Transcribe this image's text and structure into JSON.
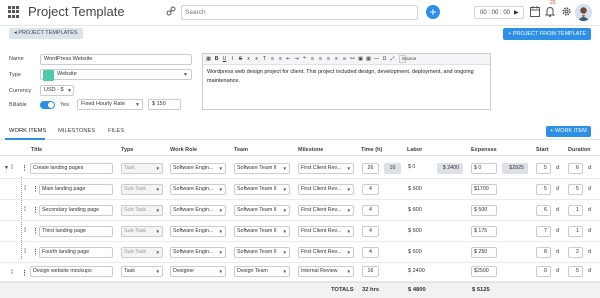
{
  "header": {
    "title": "Project Template",
    "search_placeholder": "Search",
    "timer": "00 : 00 : 00",
    "notification_count": "20"
  },
  "subheader": {
    "back_label": "PROJECT TEMPLATES",
    "from_template_label": "PROJECT FROM TEMPLATE"
  },
  "form": {
    "name_label": "Name",
    "name_value": "WordPress Website",
    "type_label": "Type",
    "type_value": "Website",
    "type_color": "#4ec9b0",
    "currency_label": "Currency",
    "currency_value": "USD - $",
    "billable_label": "Billable",
    "billable_toggle": "Yes",
    "rate_type": "Fixed Hourly Rate",
    "rate_value": "$ 150"
  },
  "editor": {
    "source_label": "Source",
    "text": "Wordpress web design project for client. This project included design, development, deployment, and ongoing maintenance."
  },
  "tabs": [
    {
      "label": "WORK ITEMS",
      "active": true
    },
    {
      "label": "MILESTONES",
      "active": false
    },
    {
      "label": "FILES",
      "active": false
    }
  ],
  "add_work_item_label": "WORK ITEM",
  "columns": {
    "title": "Title",
    "type": "Type",
    "role": "Work Role",
    "team": "Team",
    "milestone": "Milestone",
    "time": "Time (h)",
    "labor": "Labor",
    "expenses": "Expenses",
    "start": "Start",
    "duration": "Duration"
  },
  "rows": [
    {
      "title": "Create landing pages",
      "type": "Task",
      "role": "Software Engin...",
      "team": "Software Team II",
      "milestone": "First Client Rev...",
      "time": "26",
      "time_extra": "16",
      "labor": "$ 0",
      "labor_extra": "$ 2400",
      "expenses": "$ 0",
      "expenses_extra": "$2925",
      "start": "5",
      "start_unit": "d",
      "duration": "6",
      "duration_unit": "d"
    },
    {
      "title": "Main landing page",
      "type": "Sub-Task",
      "role": "Software Engin...",
      "team": "Software Team II",
      "milestone": "First Client Rev...",
      "time": "4",
      "labor": "$ 600",
      "expenses": "$1700",
      "start": "5",
      "start_unit": "d",
      "duration": "5",
      "duration_unit": "d"
    },
    {
      "title": "Secondary landing page",
      "type": "Sub-Task",
      "role": "Software Engin...",
      "team": "Software Team II",
      "milestone": "First Client Rev...",
      "time": "4",
      "labor": "$ 600",
      "expenses": "$  500",
      "start": "6",
      "start_unit": "d",
      "duration": "1",
      "duration_unit": "d"
    },
    {
      "title": "Third landing page",
      "type": "Sub-Task",
      "role": "Software Engin...",
      "team": "Software Team II",
      "milestone": "First Client Rev...",
      "time": "4",
      "labor": "$ 600",
      "expenses": "$  175",
      "start": "7",
      "start_unit": "d",
      "duration": "1",
      "duration_unit": "d"
    },
    {
      "title": "Fourth landing page",
      "type": "Sub-Task",
      "role": "Software Engin...",
      "team": "Software Team II",
      "milestone": "First Client Rev...",
      "time": "4",
      "labor": "$ 600",
      "expenses": "$  250",
      "start": "8",
      "start_unit": "d",
      "duration": "2",
      "duration_unit": "d"
    },
    {
      "title": "Design website mockups",
      "type": "Task",
      "role": "Designer",
      "team": "Design Team",
      "milestone": "Internal Review",
      "time": "16",
      "labor": "$ 2400",
      "expenses": "$2500",
      "start": "0",
      "start_unit": "d",
      "duration": "5",
      "duration_unit": "d"
    }
  ],
  "totals": {
    "label": "TOTALS",
    "time": "32 hrs",
    "labor": "$ 4800",
    "expenses": "$ 5125"
  }
}
